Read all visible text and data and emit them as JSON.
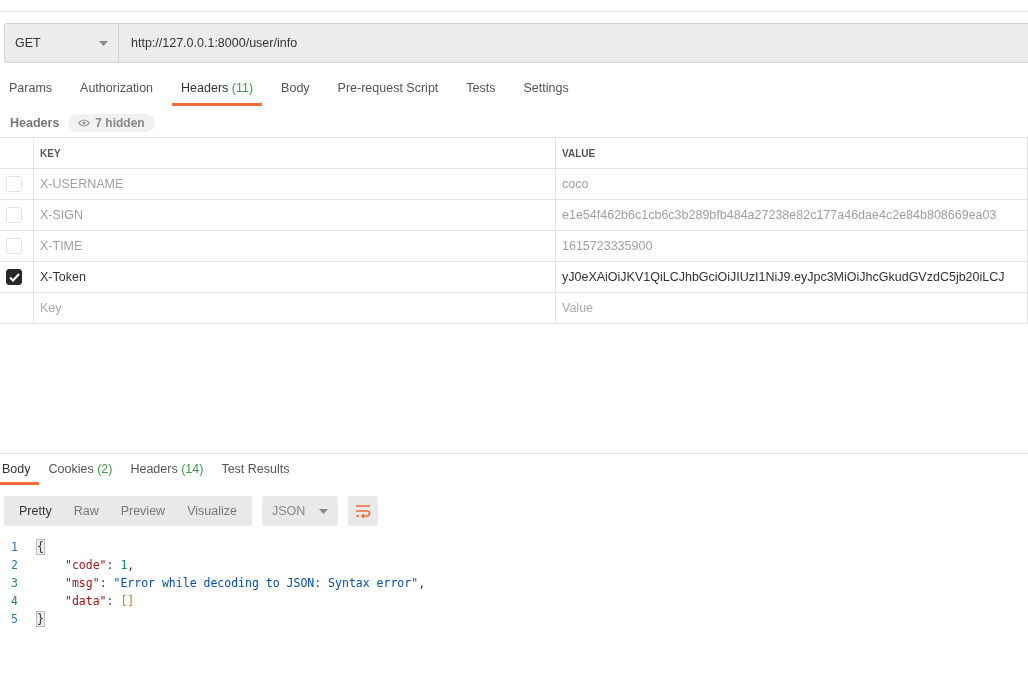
{
  "request": {
    "method": "GET",
    "url": "http://127.0.0.1:8000/user/info"
  },
  "request_tabs": [
    {
      "label": "Params",
      "selected": false
    },
    {
      "label": "Authorization",
      "selected": false
    },
    {
      "label": "Headers",
      "count": "(11)",
      "selected": true
    },
    {
      "label": "Body",
      "selected": false
    },
    {
      "label": "Pre-request Script",
      "selected": false
    },
    {
      "label": "Tests",
      "selected": false
    },
    {
      "label": "Settings",
      "selected": false
    }
  ],
  "headers_section": {
    "title": "Headers",
    "hidden_badge": "7 hidden"
  },
  "headers_table": {
    "columns": [
      "KEY",
      "VALUE"
    ],
    "rows": [
      {
        "key": "X-USERNAME",
        "value": "coco",
        "checked": false
      },
      {
        "key": "X-SIGN",
        "value": "e1e54f462b6c1cb6c3b289bfb484a27238e82c177a46dae4c2e84b808669ea03",
        "checked": false
      },
      {
        "key": "X-TIME",
        "value": "1615723335900",
        "checked": false
      },
      {
        "key": "X-Token",
        "value": "yJ0eXAiOiJKV1QiLCJhbGciOiJIUzI1NiJ9.eyJpc3MiOiJhcGkudGVzdC5jb20iLCJ",
        "checked": true
      }
    ],
    "new_row": {
      "key_placeholder": "Key",
      "value_placeholder": "Value"
    }
  },
  "response_tabs": [
    {
      "label": "Body",
      "selected": true
    },
    {
      "label": "Cookies",
      "count": "(2)",
      "selected": false
    },
    {
      "label": "Headers",
      "count": "(14)",
      "selected": false
    },
    {
      "label": "Test Results",
      "selected": false
    }
  ],
  "view_modes": [
    {
      "label": "Pretty",
      "selected": true
    },
    {
      "label": "Raw",
      "selected": false
    },
    {
      "label": "Preview",
      "selected": false
    },
    {
      "label": "Visualize",
      "selected": false
    }
  ],
  "format_dropdown": "JSON",
  "code_lines": [
    {
      "number": "1",
      "tokens": [
        {
          "kind": "bracket",
          "text": "{"
        }
      ]
    },
    {
      "number": "2",
      "tokens": [
        {
          "kind": "key",
          "text": "\"code\""
        },
        {
          "kind": "punct",
          "text": ": "
        },
        {
          "kind": "number",
          "text": "1"
        },
        {
          "kind": "punct",
          "text": ","
        }
      ]
    },
    {
      "number": "3",
      "tokens": [
        {
          "kind": "key",
          "text": "\"msg\""
        },
        {
          "kind": "punct",
          "text": ": "
        },
        {
          "kind": "string",
          "text": "\"Error while decoding to JSON: Syntax error\""
        },
        {
          "kind": "punct",
          "text": ","
        }
      ]
    },
    {
      "number": "4",
      "tokens": [
        {
          "kind": "key",
          "text": "\"data\""
        },
        {
          "kind": "punct",
          "text": ": "
        },
        {
          "kind": "array",
          "text": "[]"
        }
      ]
    },
    {
      "number": "5",
      "tokens": [
        {
          "kind": "bracket",
          "text": "}"
        }
      ]
    }
  ]
}
